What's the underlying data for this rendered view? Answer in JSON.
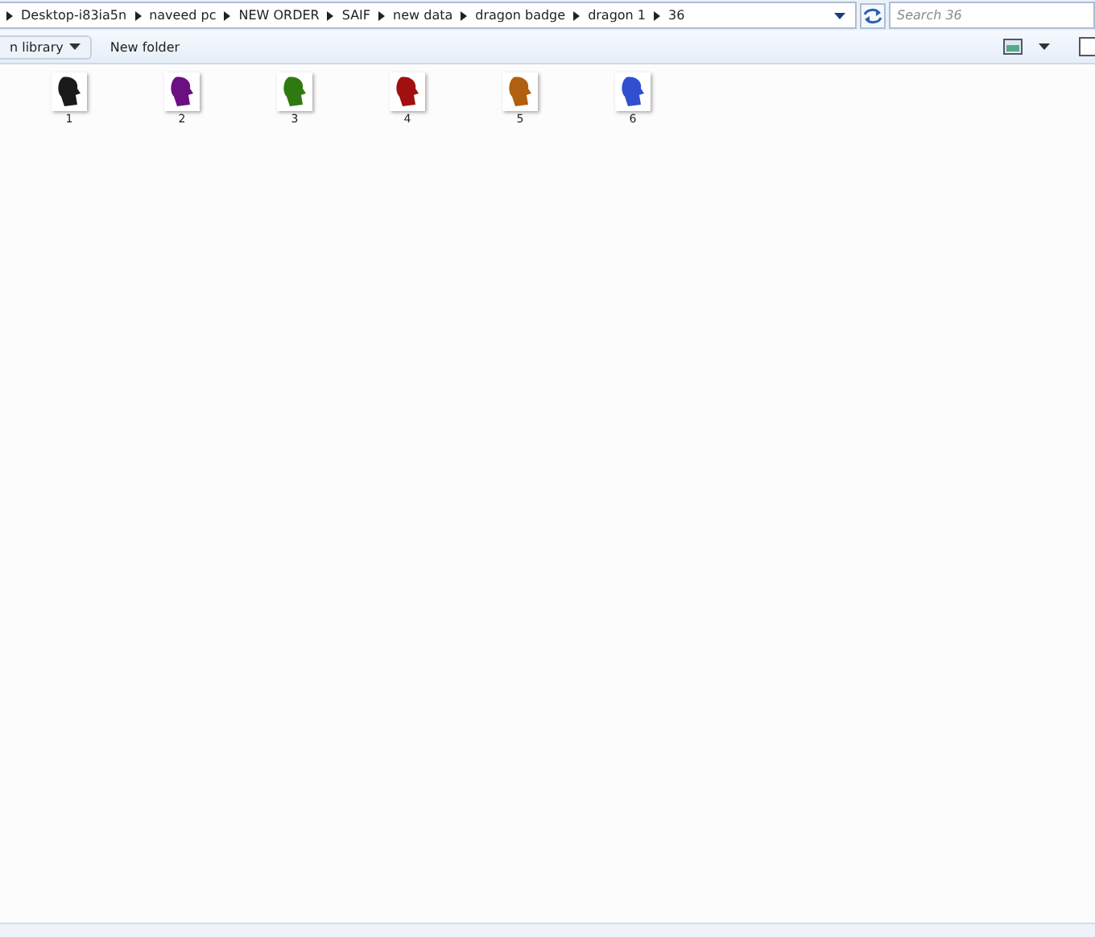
{
  "address_bar": {
    "crumbs": [
      "Desktop-i83ia5n",
      "naveed pc",
      "NEW ORDER",
      "SAIF",
      "new data",
      "dragon badge",
      "dragon 1",
      "36"
    ]
  },
  "search": {
    "placeholder": "Search 36"
  },
  "toolbar": {
    "buttons": [
      {
        "label": "n library",
        "kind": "dropdown"
      },
      {
        "label": "New folder",
        "kind": "plain"
      }
    ]
  },
  "files": [
    {
      "name": "1",
      "color": "#1a1a1a"
    },
    {
      "name": "2",
      "color": "#6a1080"
    },
    {
      "name": "3",
      "color": "#2f7a10"
    },
    {
      "name": "4",
      "color": "#a01010"
    },
    {
      "name": "5",
      "color": "#b06010"
    },
    {
      "name": "6",
      "color": "#3050d0"
    }
  ]
}
